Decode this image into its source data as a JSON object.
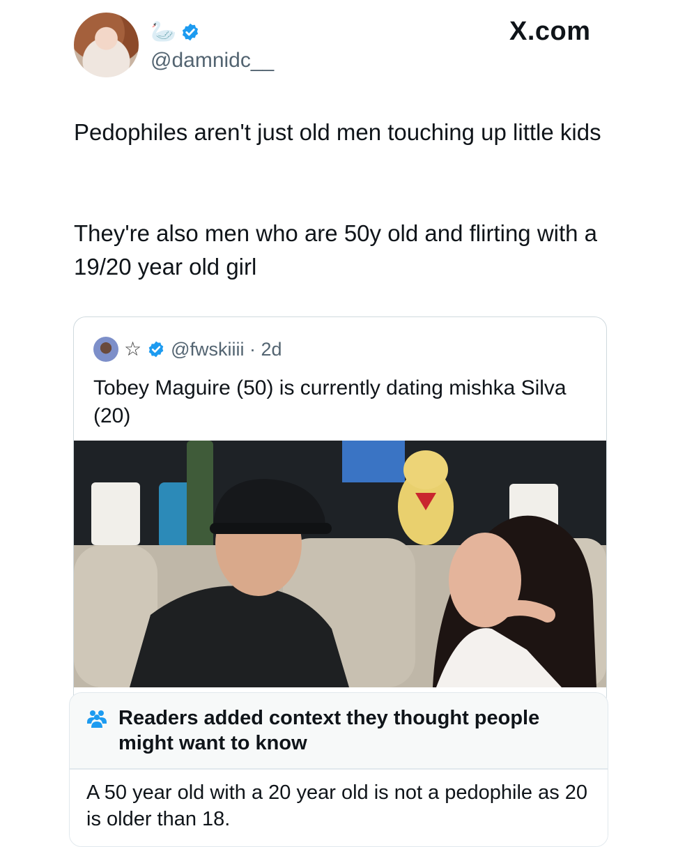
{
  "author": {
    "emoji": "🦢",
    "handle": "@damnidc__",
    "verified": true
  },
  "watermark": "X.com",
  "tweet": {
    "paragraph1": "Pedophiles aren't just old men touching up little kids",
    "paragraph2": "They're also men who are 50y old and flirting with a 19/20 year old girl"
  },
  "quoted_tweet": {
    "star": "☆",
    "handle_time": "@fwskiiii · 2d",
    "verified": true,
    "text": "Tobey Maguire (50) is currently dating mishka Silva (20)"
  },
  "community_note": {
    "icon": "people-icon",
    "title": "Readers added context they thought people might want to know",
    "body": "A 50 year old with a 20 year old is not a pedophile as 20 is older than 18."
  },
  "colors": {
    "verified_blue": "#1d9bf0",
    "note_icon_blue": "#1d9bf0",
    "secondary_text": "#536471"
  }
}
